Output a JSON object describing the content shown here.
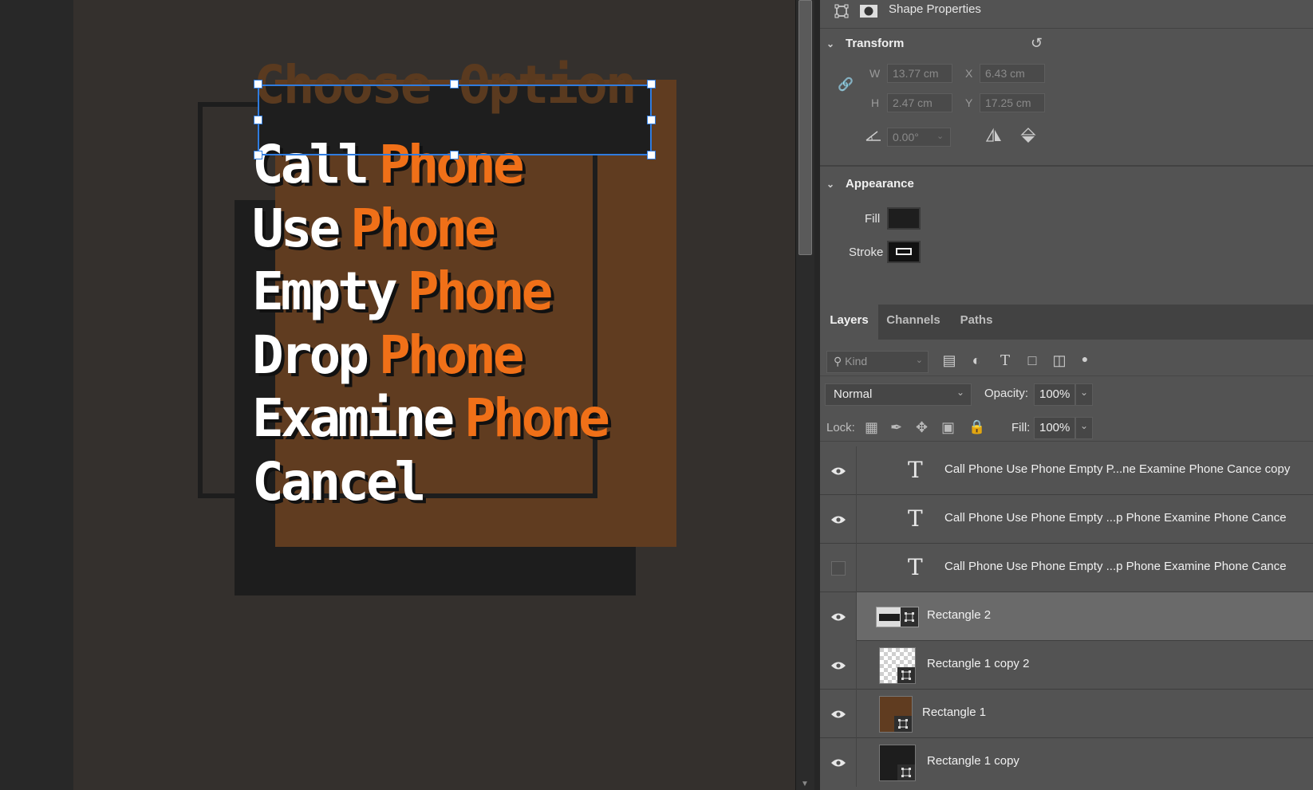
{
  "canvas": {
    "menu_title": "Choose Option",
    "menu_items": [
      {
        "word": "Call",
        "accent": "Phone"
      },
      {
        "word": "Use",
        "accent": "Phone"
      },
      {
        "word": "Empty",
        "accent": "Phone"
      },
      {
        "word": "Drop",
        "accent": "Phone"
      },
      {
        "word": "Examine",
        "accent": "Phone"
      },
      {
        "word": "Cancel",
        "accent": ""
      }
    ],
    "colors": {
      "accent_orange": "#f07018",
      "brown": "#603c20",
      "dark": "#1d1d1d",
      "selection_blue": "#2f7ce0"
    }
  },
  "properties": {
    "header_title": "Shape Properties",
    "header_icons": [
      "live-shape-icon",
      "mask-icon"
    ],
    "transform": {
      "title": "Transform",
      "w_label": "W",
      "w_value": "13.77 cm",
      "x_label": "X",
      "x_value": "6.43 cm",
      "h_label": "H",
      "h_value": "2.47 cm",
      "y_label": "Y",
      "y_value": "17.25 cm",
      "angle_value": "0.00°"
    },
    "appearance": {
      "title": "Appearance",
      "fill_label": "Fill",
      "stroke_label": "Stroke",
      "fill_color": "#1e1e1e"
    }
  },
  "layers_panel": {
    "tabs": [
      "Layers",
      "Channels",
      "Paths"
    ],
    "kind_placeholder": "Kind",
    "blend_mode": "Normal",
    "opacity_label": "Opacity:",
    "opacity_value": "100%",
    "lock_label": "Lock:",
    "fill_label": "Fill:",
    "fill_value": "100%",
    "layers": [
      {
        "name": "Call Phone Use Phone Empty P...ne Examine Phone Cance copy",
        "type": "text",
        "visible": true
      },
      {
        "name": "Call Phone Use Phone Empty ...p Phone Examine Phone Cance",
        "type": "text",
        "visible": true
      },
      {
        "name": "Call Phone Use Phone Empty ...p Phone Examine Phone Cance",
        "type": "text",
        "visible": false
      },
      {
        "name": "Rectangle 2",
        "type": "shape",
        "visible": true,
        "selected": true
      },
      {
        "name": "Rectangle 1 copy 2",
        "type": "shape",
        "visible": true
      },
      {
        "name": "Rectangle 1",
        "type": "shape",
        "visible": true
      },
      {
        "name": "Rectangle 1 copy",
        "type": "shape",
        "visible": true
      }
    ]
  }
}
